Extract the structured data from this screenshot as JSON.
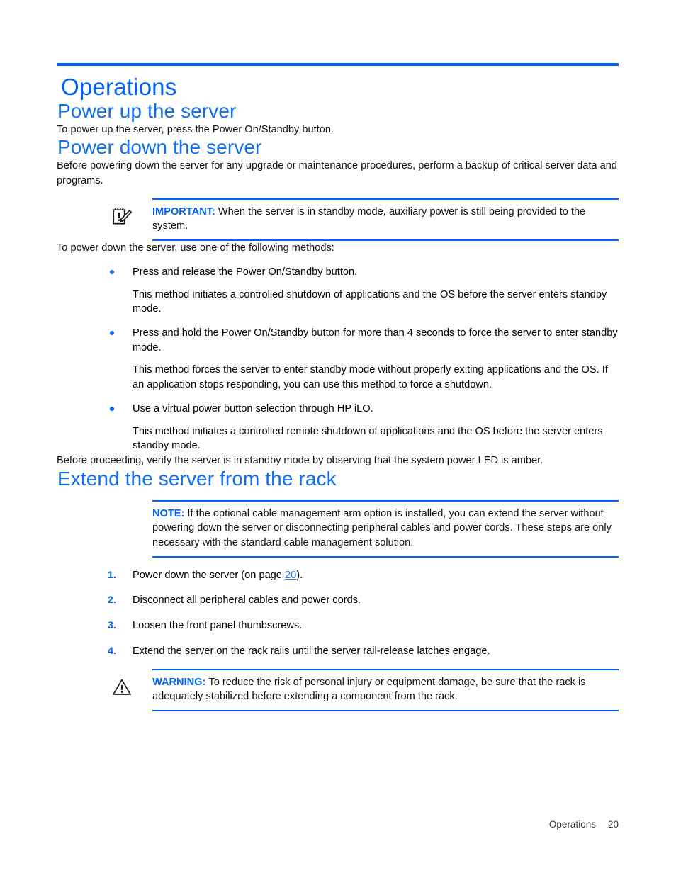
{
  "document": {
    "chapter_title": "Operations",
    "accent_color": "#0061f2",
    "link_color": "#2f7bf0"
  },
  "sections": {
    "power_up": {
      "heading": "Power up the server",
      "paragraph": "To power up the server, press the Power On/Standby button."
    },
    "power_down": {
      "heading": "Power down the server",
      "intro": "Before powering down the server for any upgrade or maintenance procedures, perform a backup of critical server data and programs.",
      "important": {
        "icon": "notepad-pencil-icon",
        "label": "IMPORTANT:",
        "text": "When the server is in standby mode, auxiliary power is still being provided to the system."
      },
      "methods_intro": "To power down the server, use one of the following methods:",
      "methods": [
        {
          "bullet": "Press and release the Power On/Standby button.",
          "detail": "This method initiates a controlled shutdown of applications and the OS before the server enters standby mode."
        },
        {
          "bullet": "Press and hold the Power On/Standby button for more than 4 seconds to force the server to enter standby mode.",
          "detail": "This method forces the server to enter standby mode without properly exiting applications and the OS. If an application stops responding, you can use this method to force a shutdown."
        },
        {
          "bullet": "Use a virtual power button selection through HP iLO.",
          "detail": "This method initiates a controlled remote shutdown of applications and the OS before the server enters standby mode."
        }
      ],
      "closing": "Before proceeding, verify the server is in standby mode by observing that the system power LED is amber."
    },
    "extend": {
      "heading": "Extend the server from the rack",
      "note": {
        "label": "NOTE:",
        "text": "If the optional cable management arm option is installed, you can extend the server without powering down the server or disconnecting peripheral cables and power cords. These steps are only necessary with the standard cable management solution."
      },
      "steps": [
        {
          "num": "1.",
          "text_before": "Power down the server (on page ",
          "link": "20",
          "text_after": ")."
        },
        {
          "num": "2.",
          "text_before": "Disconnect all peripheral cables and power cords.",
          "link": "",
          "text_after": ""
        },
        {
          "num": "3.",
          "text_before": "Loosen the front panel thumbscrews.",
          "link": "",
          "text_after": ""
        },
        {
          "num": "4.",
          "text_before": "Extend the server on the rack rails until the server rail-release latches engage.",
          "link": "",
          "text_after": ""
        }
      ],
      "warning": {
        "icon": "warning-triangle-icon",
        "label": "WARNING:",
        "text": "To reduce the risk of personal injury or equipment damage, be sure that the rack is adequately stabilized before extending a component from the rack."
      }
    }
  },
  "footer": {
    "chapter": "Operations",
    "page_number": "20"
  }
}
